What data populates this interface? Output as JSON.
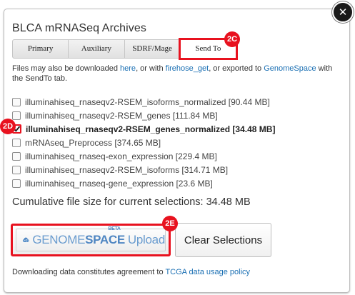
{
  "dialog": {
    "title": "BLCA mRNASeq Archives",
    "close_symbol": "✕"
  },
  "tabs": [
    {
      "label": "Primary",
      "active": false
    },
    {
      "label": "Auxiliary",
      "active": false
    },
    {
      "label": "SDRF/Mage",
      "active": false
    },
    {
      "label": "Send To",
      "active": true
    }
  ],
  "callouts": {
    "tab": "2C",
    "selected_file": "2D",
    "upload": "2E"
  },
  "info": {
    "prefix": "Files may also be downloaded ",
    "link_here": "here",
    "middle": ", or with ",
    "link_firehose": "firehose_get",
    "middle2": ", or exported to ",
    "link_genomespace": "GenomeSpace",
    "suffix": " with the SendTo tab."
  },
  "files": [
    {
      "name": "illuminahiseq_rnaseqv2-RSEM_isoforms_normalized [90.44 MB]",
      "checked": false
    },
    {
      "name": "illuminahiseq_rnaseqv2-RSEM_genes [111.84 MB]",
      "checked": false
    },
    {
      "name": "illuminahiseq_rnaseqv2-RSEM_genes_normalized [34.48 MB]",
      "checked": true
    },
    {
      "name": "mRNAseq_Preprocess [374.65 MB]",
      "checked": false
    },
    {
      "name": "illuminahiseq_rnaseq-exon_expression [229.4 MB]",
      "checked": false
    },
    {
      "name": "illuminahiseq_rnaseqv2-RSEM_isoforms [314.71 MB]",
      "checked": false
    },
    {
      "name": "illuminahiseq_rnaseq-gene_expression [23.6 MB]",
      "checked": false
    }
  ],
  "cumulative": "Cumulative file size for current selections: 34.48 MB",
  "genomespace_button": {
    "genome": "GENOME",
    "space": "SPACE",
    "beta": "BETA",
    "upload": "Upload"
  },
  "clear_button": "Clear Selections",
  "footer": {
    "prefix": "Downloading data constitutes agreement to ",
    "link": "TCGA data usage policy"
  },
  "colors": {
    "highlight": "#e8121f",
    "link": "#1a6fb3",
    "genomespace_blue": "#4f86c2"
  }
}
